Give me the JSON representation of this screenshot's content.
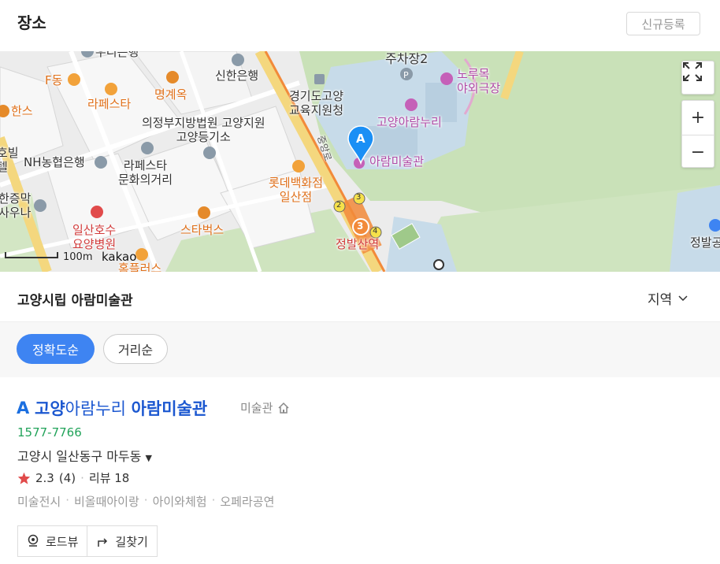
{
  "header": {
    "title": "장소",
    "new_button": "신규등록"
  },
  "map": {
    "labels": {
      "parking2": "주차장2",
      "noru_theater": "노루목\n야외극장",
      "shinhan": "신한은행",
      "gyeonggi_edu": "경기도고양\n교육지원청",
      "goyang_aram": "고양아람누리",
      "aram_museum": "아람미술관",
      "court": "의정부지방법원 고양지원\n고양등기소",
      "nh_bank": "NH농협은행",
      "lafesta_culture": "라페스타\n문화의거리",
      "lafesta": "라페스타",
      "myeonggyeok": "명계옥",
      "f_dong": "F동",
      "hanseu": "한스",
      "lotte": "롯데백화점\n일산점",
      "starbucks": "스타벅스",
      "ilsan_hospital": "일산호수\n요양병원",
      "hanjungmak": "한증막\n사우나",
      "jeongbalsan": "정발산역",
      "jeongbal_right": "정발공",
      "road_name": "중앙로",
      "edge_bottom": "홈플러스",
      "edge_left_top": "우리은행",
      "edge_left_mid": "호빌\n텔",
      "station_lines": [
        "2",
        "3",
        "3",
        "4"
      ],
      "marker": "A"
    },
    "controls": {
      "zoom_in": "+",
      "zoom_out": "−"
    },
    "scale": "100m",
    "logo": "kakao"
  },
  "search": {
    "query": "고양시립 아람미술관",
    "region": "지역"
  },
  "sort": {
    "accuracy": "정확도순",
    "distance": "거리순"
  },
  "result": {
    "marker": "A",
    "name_highlight_1": "고양",
    "name_middle": "아람누리 ",
    "name_highlight_2": "아람미술관",
    "category": "미술관",
    "phone": "1577-7766",
    "address": "고양시 일산동구 마두동",
    "rating": "2.3",
    "rating_count": "(4)",
    "review_label": "리뷰 18",
    "tags": [
      "미술전시",
      "비올때아이랑",
      "아이와체험",
      "오페라공연"
    ],
    "actions": {
      "roadview": "로드뷰",
      "directions": "길찾기"
    }
  },
  "colors": {
    "accent": "#3e84f2",
    "name_blue": "#1b57d0",
    "phone_green": "#22a35a",
    "star_red": "#e14b4b",
    "road_yellow": "#f4d77e",
    "subway_orange": "#f28a3a"
  }
}
